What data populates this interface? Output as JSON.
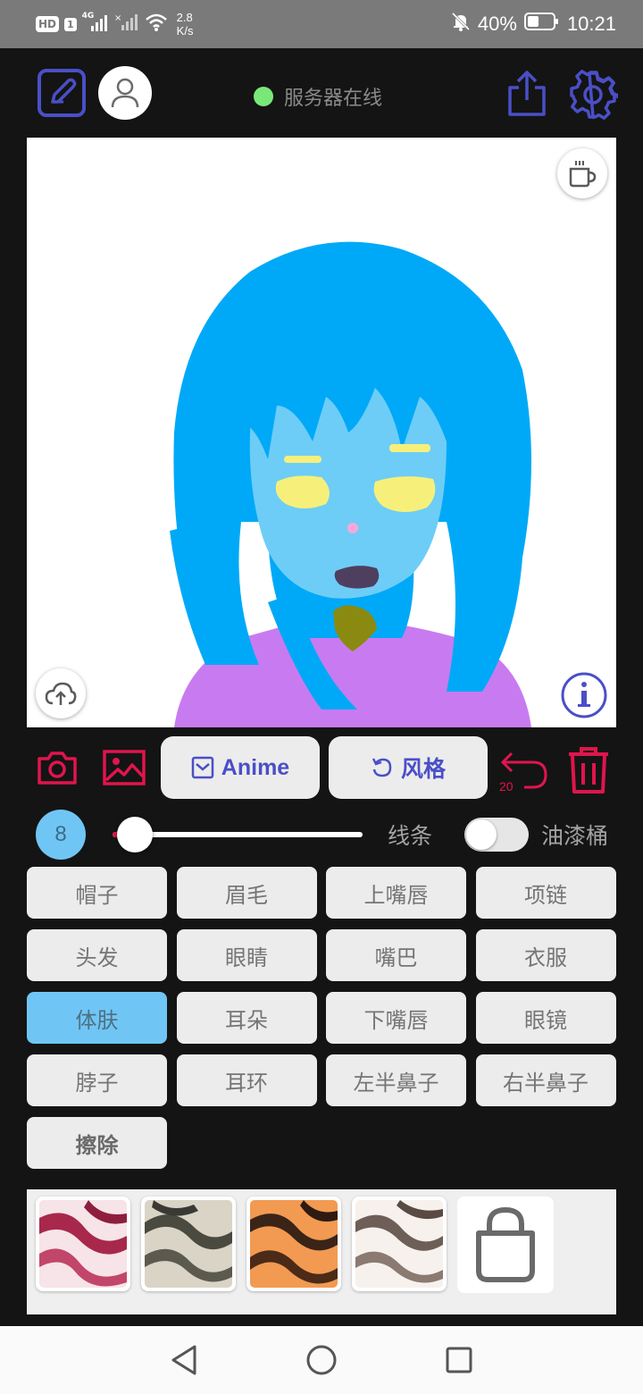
{
  "status_bar": {
    "hd": "HD",
    "sim": "1",
    "net": "4G",
    "speed_value": "2.8",
    "speed_unit": "K/s",
    "battery": "40%",
    "time": "10:21"
  },
  "toolbar": {
    "server_status": "服务器在线"
  },
  "actions": {
    "anime_label": "Anime",
    "style_label": "风格",
    "undo_count": "20"
  },
  "brush": {
    "size": "8",
    "slider_level": 0.09,
    "mode_label": "线条",
    "bucket_label": "油漆桶",
    "bucket_on": false
  },
  "parts": [
    {
      "label": "帽子"
    },
    {
      "label": "眉毛"
    },
    {
      "label": "上嘴唇"
    },
    {
      "label": "项链"
    },
    {
      "label": "头发"
    },
    {
      "label": "眼睛"
    },
    {
      "label": "嘴巴"
    },
    {
      "label": "衣服"
    },
    {
      "label": "体肤",
      "active": true
    },
    {
      "label": "耳朵"
    },
    {
      "label": "下嘴唇"
    },
    {
      "label": "眼镜"
    },
    {
      "label": "脖子"
    },
    {
      "label": "耳环"
    },
    {
      "label": "左半鼻子"
    },
    {
      "label": "右半鼻子"
    },
    {
      "label": "擦除"
    }
  ],
  "colors": {
    "accent_purple": "#4a4fc7",
    "accent_red": "#e0154d",
    "active_blue": "#6fc6f4",
    "online_green": "#79e879",
    "hair": "#00a9f7",
    "skin": "#6dcdf7",
    "shirt": "#c87bf0"
  }
}
